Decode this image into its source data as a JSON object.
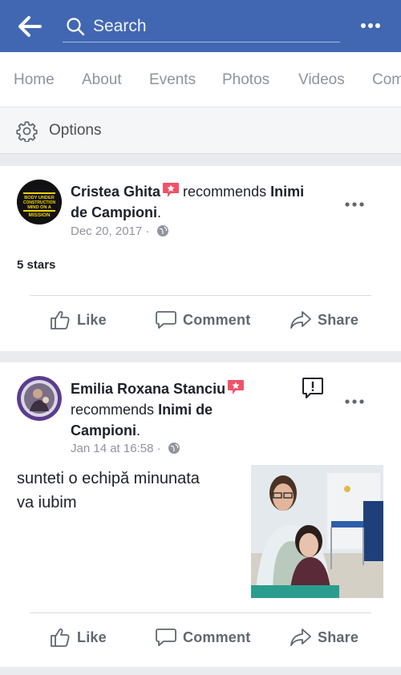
{
  "header": {
    "search_placeholder": "Search",
    "back_icon": "arrow-left-icon",
    "more_icon": "more-horizontal-icon"
  },
  "tabs": [
    {
      "label": "Home"
    },
    {
      "label": "About"
    },
    {
      "label": "Events"
    },
    {
      "label": "Photos"
    },
    {
      "label": "Videos"
    },
    {
      "label": "Com"
    }
  ],
  "options": {
    "label": "Options",
    "icon": "gear-icon"
  },
  "posts": [
    {
      "author": "Cristea Ghita",
      "verb": "recommends",
      "page": "Inimi de Campioni",
      "date": "Dec 20, 2017 ·",
      "rating_text": "5 stars",
      "avatar_text": [
        "BODY UNDER",
        "CONSTRUCTION",
        "MIND ON A",
        "MISSION"
      ]
    },
    {
      "author": "Emilia Roxana Stanciu",
      "verb": "recommends",
      "page": "Inimi de Campioni",
      "date": "Jan 14 at 16:58 ·",
      "body_line1": "sunteti o echipă  minunata",
      "body_line2": "va iubim"
    }
  ],
  "actions": {
    "like": "Like",
    "comment": "Comment",
    "share": "Share"
  },
  "colors": {
    "brand": "#4267b2",
    "badge": "#f25268",
    "muted": "#90949c"
  }
}
